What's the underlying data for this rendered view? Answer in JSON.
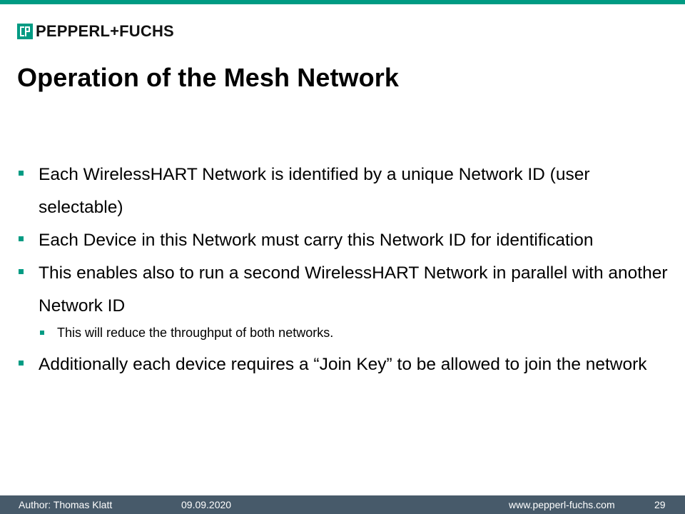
{
  "brand": {
    "logo_text": "PEPPERL+FUCHS",
    "logo_icon": "pf-logo-icon",
    "accent_color": "#009b83",
    "footer_color": "#475a6a"
  },
  "slide": {
    "title": "Operation of the Mesh Network",
    "bullets": [
      "Each WirelessHART Network is identified by a unique Network ID (user selectable)",
      "Each Device in this Network must carry this Network ID for identification",
      "This enables also to run a second WirelessHART Network in parallel with another Network ID",
      "Additionally each device requires a “Join Key” to be allowed to join the network"
    ],
    "sub_bullet": "This will reduce the throughput of both networks."
  },
  "footer": {
    "author": "Author:  Thomas Klatt",
    "date": "09.09.2020",
    "url": "www.pepperl-fuchs.com",
    "page": "29"
  }
}
